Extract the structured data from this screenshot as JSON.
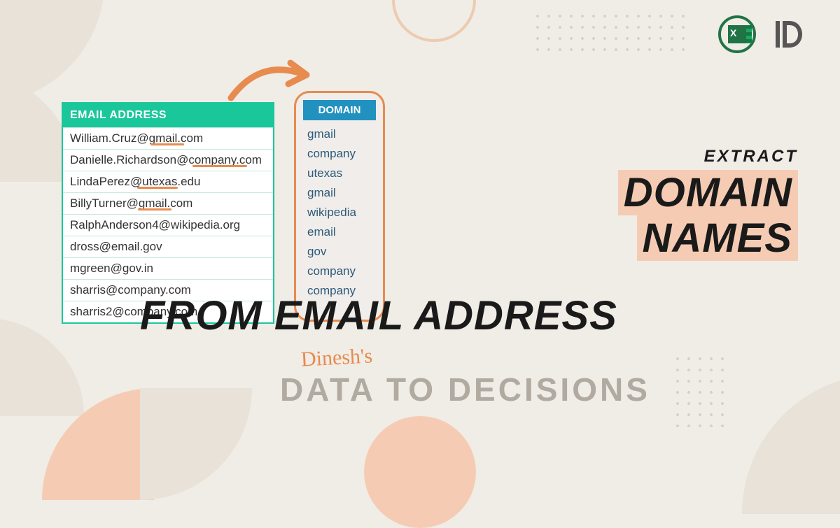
{
  "email_table": {
    "header": "EMAIL ADDRESS",
    "rows": [
      "William.Cruz@gmail.com",
      "Danielle.Richardson@company.com",
      "LindaPerez@utexas.edu",
      "BillyTurner@gmail.com",
      "RalphAnderson4@wikipedia.org",
      "dross@email.gov",
      "mgreen@gov.in",
      "sharris@company.com",
      "sharris2@company.com"
    ]
  },
  "domain_table": {
    "header": "DOMAIN",
    "rows": [
      "gmail",
      "company",
      "utexas",
      "gmail",
      "wikipedia",
      "email",
      "gov",
      "company",
      "company"
    ]
  },
  "title": {
    "small": "EXTRACT",
    "line1": "DOMAIN",
    "line2": "NAMES",
    "line3": "FROM EMAIL ADDRESS"
  },
  "subtitle": {
    "script": "Dinesh's",
    "main": "DATA TO DECISIONS"
  }
}
